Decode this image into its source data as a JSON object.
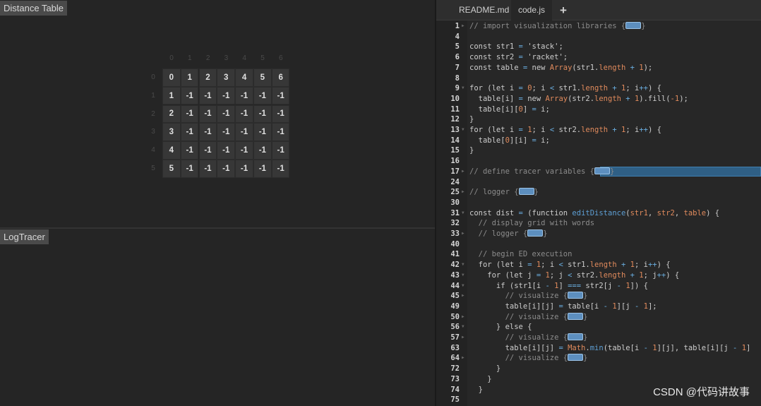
{
  "panels": {
    "distance_table": "Distance Table",
    "log_tracer": "LogTracer"
  },
  "table": {
    "col_headers": [
      "0",
      "1",
      "2",
      "3",
      "4",
      "5",
      "6"
    ],
    "row_headers": [
      "0",
      "1",
      "2",
      "3",
      "4",
      "5"
    ],
    "rows": [
      [
        "0",
        "1",
        "2",
        "3",
        "4",
        "5",
        "6"
      ],
      [
        "1",
        "-1",
        "-1",
        "-1",
        "-1",
        "-1",
        "-1"
      ],
      [
        "2",
        "-1",
        "-1",
        "-1",
        "-1",
        "-1",
        "-1"
      ],
      [
        "3",
        "-1",
        "-1",
        "-1",
        "-1",
        "-1",
        "-1"
      ],
      [
        "4",
        "-1",
        "-1",
        "-1",
        "-1",
        "-1",
        "-1"
      ],
      [
        "5",
        "-1",
        "-1",
        "-1",
        "-1",
        "-1",
        "-1"
      ]
    ]
  },
  "editor": {
    "tabs": [
      {
        "label": "README.md",
        "active": false
      },
      {
        "label": "code.js",
        "active": true
      }
    ],
    "add_tab": "+",
    "highlight_color": "#2f5f85",
    "lines": [
      {
        "n": "1",
        "fold": "right",
        "t": [
          [
            "// import visualization libraries {",
            "c"
          ],
          [
            "",
            "fold"
          ],
          [
            "}",
            "c"
          ]
        ]
      },
      {
        "n": "4",
        "t": []
      },
      {
        "n": "5",
        "t": [
          [
            "const str1 ",
            ""
          ],
          [
            "=",
            "b"
          ],
          [
            " 'stack';",
            ""
          ]
        ]
      },
      {
        "n": "6",
        "t": [
          [
            "const str2 ",
            ""
          ],
          [
            "=",
            "b"
          ],
          [
            " 'racket';",
            ""
          ]
        ]
      },
      {
        "n": "7",
        "t": [
          [
            "const table ",
            ""
          ],
          [
            "=",
            "b"
          ],
          [
            " new ",
            ""
          ],
          [
            "Array",
            "o"
          ],
          [
            "(str1.",
            ""
          ],
          [
            "length",
            "o"
          ],
          [
            " ",
            ""
          ],
          [
            "+",
            "b"
          ],
          [
            " ",
            ""
          ],
          [
            "1",
            "o"
          ],
          [
            ");",
            ""
          ]
        ]
      },
      {
        "n": "8",
        "t": []
      },
      {
        "n": "9",
        "fold": "down",
        "t": [
          [
            "for (let i ",
            ""
          ],
          [
            "=",
            "b"
          ],
          [
            " ",
            ""
          ],
          [
            "0",
            "o"
          ],
          [
            "; i ",
            ""
          ],
          [
            "<",
            "b"
          ],
          [
            " str1.",
            ""
          ],
          [
            "length",
            "o"
          ],
          [
            " ",
            ""
          ],
          [
            "+",
            "b"
          ],
          [
            " ",
            ""
          ],
          [
            "1",
            "o"
          ],
          [
            "; i",
            ""
          ],
          [
            "++",
            "b"
          ],
          [
            ") {",
            ""
          ]
        ]
      },
      {
        "n": "10",
        "t": [
          [
            "  table[i] ",
            ""
          ],
          [
            "=",
            "b"
          ],
          [
            " new ",
            ""
          ],
          [
            "Array",
            "o"
          ],
          [
            "(str2.",
            ""
          ],
          [
            "length",
            "o"
          ],
          [
            " ",
            ""
          ],
          [
            "+",
            "b"
          ],
          [
            " ",
            ""
          ],
          [
            "1",
            "o"
          ],
          [
            ").fill(",
            ""
          ],
          [
            "-1",
            "o"
          ],
          [
            ");",
            ""
          ]
        ]
      },
      {
        "n": "11",
        "t": [
          [
            "  table[i][",
            ""
          ],
          [
            "0",
            "o"
          ],
          [
            "] ",
            ""
          ],
          [
            "=",
            "b"
          ],
          [
            " i;",
            ""
          ]
        ]
      },
      {
        "n": "12",
        "t": [
          [
            "}",
            ""
          ]
        ]
      },
      {
        "n": "13",
        "fold": "down",
        "t": [
          [
            "for (let i ",
            ""
          ],
          [
            "=",
            "b"
          ],
          [
            " ",
            ""
          ],
          [
            "1",
            "o"
          ],
          [
            "; i ",
            ""
          ],
          [
            "<",
            "b"
          ],
          [
            " str2.",
            ""
          ],
          [
            "length",
            "o"
          ],
          [
            " ",
            ""
          ],
          [
            "+",
            "b"
          ],
          [
            " ",
            ""
          ],
          [
            "1",
            "o"
          ],
          [
            "; i",
            ""
          ],
          [
            "++",
            "b"
          ],
          [
            ") {",
            ""
          ]
        ]
      },
      {
        "n": "14",
        "t": [
          [
            "  table[",
            ""
          ],
          [
            "0",
            "o"
          ],
          [
            "][i] ",
            ""
          ],
          [
            "=",
            "b"
          ],
          [
            " i;",
            ""
          ]
        ]
      },
      {
        "n": "15",
        "t": [
          [
            "}",
            ""
          ]
        ]
      },
      {
        "n": "16",
        "t": []
      },
      {
        "n": "17",
        "fold": "right",
        "highlight": true,
        "t": [
          [
            "// define tracer variables {",
            "c"
          ],
          [
            "",
            "fold"
          ],
          [
            "}",
            "c"
          ]
        ]
      },
      {
        "n": "24",
        "t": []
      },
      {
        "n": "25",
        "fold": "right",
        "t": [
          [
            "// logger {",
            "c"
          ],
          [
            "",
            "fold"
          ],
          [
            "}",
            "c"
          ]
        ]
      },
      {
        "n": "30",
        "t": []
      },
      {
        "n": "31",
        "fold": "down",
        "t": [
          [
            "const dist ",
            ""
          ],
          [
            "=",
            "b"
          ],
          [
            " (function ",
            ""
          ],
          [
            "editDistance",
            "f"
          ],
          [
            "(",
            ""
          ],
          [
            "str1",
            "o"
          ],
          [
            ", ",
            ""
          ],
          [
            "str2",
            "o"
          ],
          [
            ", ",
            ""
          ],
          [
            "table",
            "o"
          ],
          [
            ") {",
            ""
          ]
        ]
      },
      {
        "n": "32",
        "t": [
          [
            "  ",
            ""
          ],
          [
            "// display grid with words",
            "c"
          ]
        ]
      },
      {
        "n": "33",
        "fold": "right",
        "t": [
          [
            "  ",
            ""
          ],
          [
            "// logger {",
            "c"
          ],
          [
            "",
            "fold"
          ],
          [
            "}",
            "c"
          ]
        ]
      },
      {
        "n": "40",
        "t": []
      },
      {
        "n": "41",
        "t": [
          [
            "  ",
            ""
          ],
          [
            "// begin ED execution",
            "c"
          ]
        ]
      },
      {
        "n": "42",
        "fold": "down",
        "t": [
          [
            "  for (let i ",
            ""
          ],
          [
            "=",
            "b"
          ],
          [
            " ",
            ""
          ],
          [
            "1",
            "o"
          ],
          [
            "; i ",
            ""
          ],
          [
            "<",
            "b"
          ],
          [
            " str1.",
            ""
          ],
          [
            "length",
            "o"
          ],
          [
            " ",
            ""
          ],
          [
            "+",
            "b"
          ],
          [
            " ",
            ""
          ],
          [
            "1",
            "o"
          ],
          [
            "; i",
            ""
          ],
          [
            "++",
            "b"
          ],
          [
            ") {",
            ""
          ]
        ]
      },
      {
        "n": "43",
        "fold": "down",
        "t": [
          [
            "    for (let j ",
            ""
          ],
          [
            "=",
            "b"
          ],
          [
            " ",
            ""
          ],
          [
            "1",
            "o"
          ],
          [
            "; j ",
            ""
          ],
          [
            "<",
            "b"
          ],
          [
            " str2.",
            ""
          ],
          [
            "length",
            "o"
          ],
          [
            " ",
            ""
          ],
          [
            "+",
            "b"
          ],
          [
            " ",
            ""
          ],
          [
            "1",
            "o"
          ],
          [
            "; j",
            ""
          ],
          [
            "++",
            "b"
          ],
          [
            ") {",
            ""
          ]
        ]
      },
      {
        "n": "44",
        "fold": "down",
        "t": [
          [
            "      if (str1[i ",
            ""
          ],
          [
            "-",
            "b"
          ],
          [
            " ",
            ""
          ],
          [
            "1",
            "o"
          ],
          [
            "] ",
            ""
          ],
          [
            "===",
            "b"
          ],
          [
            " str2[j ",
            ""
          ],
          [
            "-",
            "b"
          ],
          [
            " ",
            ""
          ],
          [
            "1",
            "o"
          ],
          [
            "]) {",
            ""
          ]
        ]
      },
      {
        "n": "45",
        "fold": "right",
        "t": [
          [
            "        ",
            ""
          ],
          [
            "// visualize {",
            "c"
          ],
          [
            "",
            "fold"
          ],
          [
            "}",
            "c"
          ]
        ]
      },
      {
        "n": "49",
        "t": [
          [
            "        table[i][j] ",
            ""
          ],
          [
            "=",
            "b"
          ],
          [
            " table[i ",
            ""
          ],
          [
            "-",
            "b"
          ],
          [
            " ",
            ""
          ],
          [
            "1",
            "o"
          ],
          [
            "][j ",
            ""
          ],
          [
            "-",
            "b"
          ],
          [
            " ",
            ""
          ],
          [
            "1",
            "o"
          ],
          [
            "];",
            ""
          ]
        ]
      },
      {
        "n": "50",
        "fold": "right",
        "t": [
          [
            "        ",
            ""
          ],
          [
            "// visualize {",
            "c"
          ],
          [
            "",
            "fold"
          ],
          [
            "}",
            "c"
          ]
        ]
      },
      {
        "n": "56",
        "fold": "down",
        "t": [
          [
            "      } else {",
            ""
          ]
        ]
      },
      {
        "n": "57",
        "fold": "right",
        "t": [
          [
            "        ",
            ""
          ],
          [
            "// visualize {",
            "c"
          ],
          [
            "",
            "fold"
          ],
          [
            "}",
            "c"
          ]
        ]
      },
      {
        "n": "63",
        "t": [
          [
            "        table[i][j] ",
            ""
          ],
          [
            "=",
            "b"
          ],
          [
            " ",
            ""
          ],
          [
            "Math",
            "o"
          ],
          [
            ".",
            ""
          ],
          [
            "min",
            "f"
          ],
          [
            "(table[i ",
            ""
          ],
          [
            "-",
            "b"
          ],
          [
            " ",
            ""
          ],
          [
            "1",
            "o"
          ],
          [
            "][j], table[i][j ",
            ""
          ],
          [
            "-",
            "b"
          ],
          [
            " ",
            ""
          ],
          [
            "1",
            "o"
          ],
          [
            "]",
            ""
          ]
        ]
      },
      {
        "n": "64",
        "fold": "right",
        "t": [
          [
            "        ",
            ""
          ],
          [
            "// visualize {",
            "c"
          ],
          [
            "",
            "fold"
          ],
          [
            "}",
            "c"
          ]
        ]
      },
      {
        "n": "72",
        "t": [
          [
            "      }",
            ""
          ]
        ]
      },
      {
        "n": "73",
        "t": [
          [
            "    }",
            ""
          ]
        ]
      },
      {
        "n": "74",
        "t": [
          [
            "  }",
            ""
          ]
        ]
      },
      {
        "n": "75",
        "t": []
      }
    ]
  },
  "watermark": "CSDN @代码讲故事"
}
